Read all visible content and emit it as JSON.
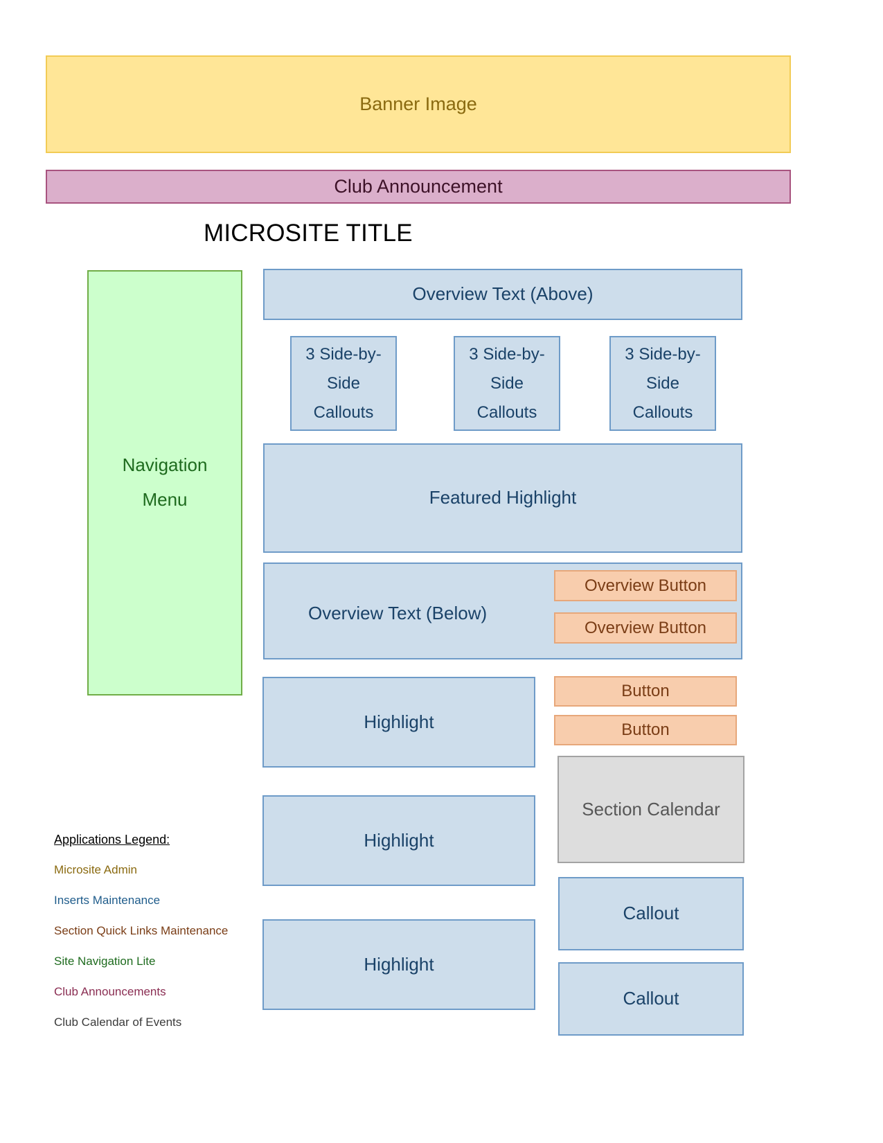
{
  "banner": {
    "label": "Banner Image",
    "fill": "#ffe697",
    "border": "#f2cb55",
    "text_color": "#8a6a10"
  },
  "announcement": {
    "label": "Club Announcement",
    "fill": "#dbafcb",
    "border": "#a8537f",
    "text_color": "#3d1228"
  },
  "page_title": "MICROSITE TITLE",
  "navigation": {
    "line1": "Navigation",
    "line2": "Menu",
    "fill": "#ccffcc",
    "border": "#70ad47",
    "text_color": "#1e6b1e"
  },
  "content": {
    "overview_above": "Overview Text (Above)",
    "callouts": [
      {
        "line1": "3 Side-by-",
        "line2": "Side",
        "line3": "Callouts"
      },
      {
        "line1": "3 Side-by-",
        "line2": "Side",
        "line3": "Callouts"
      },
      {
        "line1": "3 Side-by-",
        "line2": "Side",
        "line3": "Callouts"
      }
    ],
    "featured_highlight": "Featured Highlight",
    "overview_below": "Overview Text (Below)",
    "overview_buttons": [
      "Overview Button",
      "Overview Button"
    ],
    "highlights": [
      "Highlight",
      "Highlight",
      "Highlight"
    ],
    "buttons": [
      "Button",
      "Button"
    ],
    "section_calendar": "Section Calendar",
    "side_callouts": [
      "Callout",
      "Callout"
    ],
    "blue_fill": "#cdddeb",
    "blue_border": "#6e9bc8",
    "blue_text": "#1a4268",
    "orange_fill": "#f8cdad",
    "orange_border": "#e7a77a",
    "orange_text": "#7a3d16",
    "gray_fill": "#dddddd",
    "gray_border": "#a3a3a3",
    "gray_text": "#575757"
  },
  "legend": {
    "title": "Applications Legend:",
    "items": [
      {
        "label": "Microsite Admin",
        "color": "#8a6a10"
      },
      {
        "label": "Inserts Maintenance",
        "color": "#1f5c8b"
      },
      {
        "label": "Section Quick Links Maintenance",
        "color": "#7a3d16"
      },
      {
        "label": "Site Navigation Lite",
        "color": "#1e6b1e"
      },
      {
        "label": "Club Announcements",
        "color": "#8a2d52"
      },
      {
        "label": "Club Calendar of Events",
        "color": "#3b3b3b"
      }
    ]
  }
}
